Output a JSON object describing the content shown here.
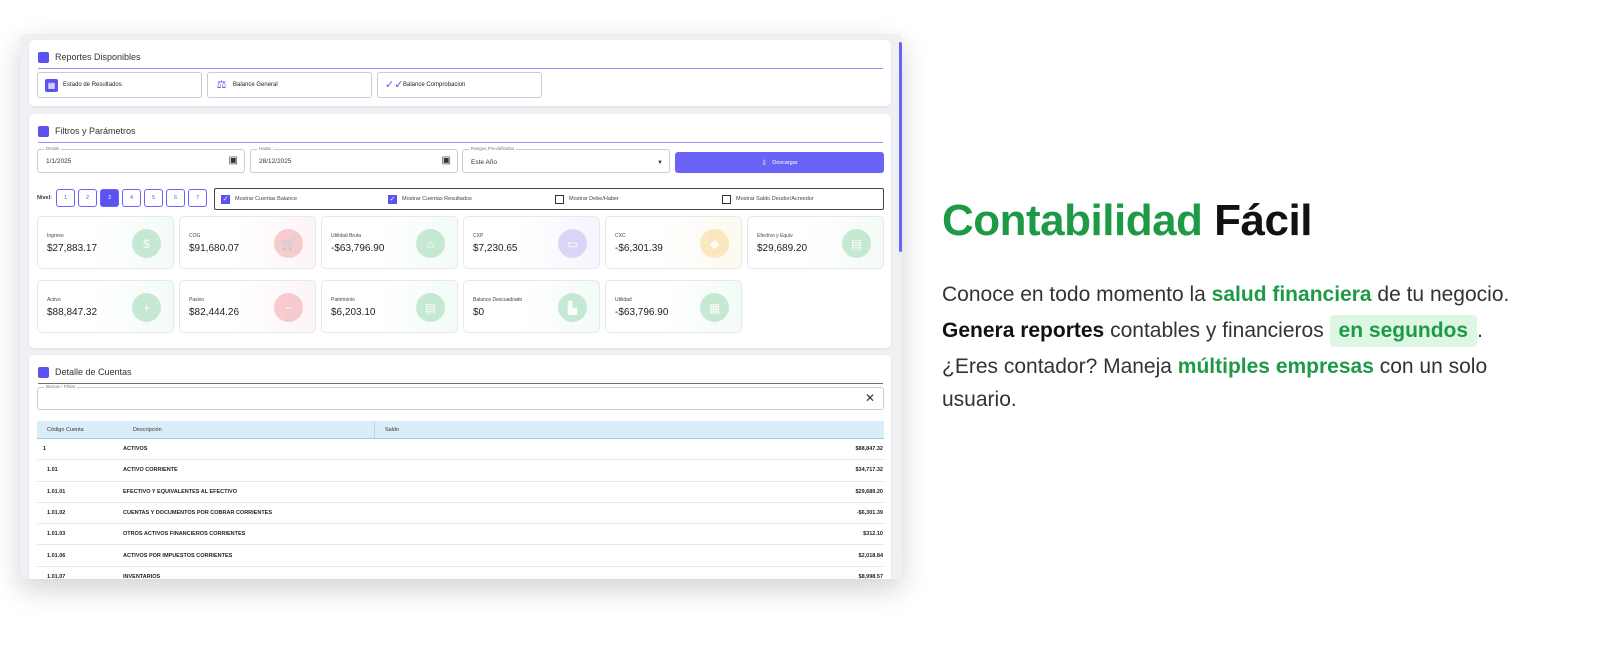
{
  "reports_panel": {
    "title": "Reportes Disponibles",
    "buttons": [
      {
        "label": "Estado de Resultados",
        "icon": "table-icon"
      },
      {
        "label": "Balance General",
        "icon": "scale-icon"
      },
      {
        "label": "Balance Comprobacion",
        "icon": "double-check-icon"
      }
    ]
  },
  "filters_panel": {
    "title": "Filtros y Parámetros",
    "desde_label": "Desde",
    "desde_value": "1/1/2025",
    "hasta_label": "Hasta",
    "hasta_value": "28/12/2025",
    "rangos_label": "Rangos Pre-definidos",
    "rangos_value": "Este Año",
    "download_label": "Descargar",
    "nivel_label": "Nivel:",
    "niveles": [
      "1",
      "2",
      "3",
      "4",
      "5",
      "6",
      "7"
    ],
    "nivel_active": "3",
    "checks": [
      {
        "label": "Mostrar Cuentas Balance",
        "checked": true
      },
      {
        "label": "Mostrar Cuentas Resultados",
        "checked": true
      },
      {
        "label": "Mostrar Debe/Haber",
        "checked": false
      },
      {
        "label": "Mostrar Saldo Deudor/Acreedor",
        "checked": false
      }
    ],
    "cards": [
      {
        "label": "Ingreso",
        "value": "$27,883.17",
        "color": "#9ed9b4",
        "bg": "#f3fbf6",
        "icon": "dollar-icon",
        "glyph": "$"
      },
      {
        "label": "COG",
        "value": "$91,680.07",
        "color": "#f2a8ad",
        "bg": "#fdf4f4",
        "icon": "cart-icon",
        "glyph": "🛒"
      },
      {
        "label": "Utilidad Bruta",
        "value": "-$63,796.90",
        "color": "#9ed9b4",
        "bg": "#f3fbf6",
        "icon": "bank-icon",
        "glyph": "⌂"
      },
      {
        "label": "CXP",
        "value": "$7,230.65",
        "color": "#c4b9f3",
        "bg": "#f6f4fd",
        "icon": "card-icon",
        "glyph": "▭"
      },
      {
        "label": "CXC",
        "value": "-$6,301.39",
        "color": "#f7d895",
        "bg": "#fdf9ef",
        "icon": "tag-icon",
        "glyph": "◆"
      },
      {
        "label": "Efectivo y Equiv.",
        "value": "$29,689.20",
        "color": "#9ed9b4",
        "bg": "#f3fbf6",
        "icon": "cash-icon",
        "glyph": "▤"
      },
      {
        "label": "Activo",
        "value": "$88,847.32",
        "color": "#9ed9b4",
        "bg": "#f3fbf6",
        "icon": "plus-icon",
        "glyph": "+"
      },
      {
        "label": "Pasivo",
        "value": "$82,444.26",
        "color": "#f2a8ad",
        "bg": "#fdf4f4",
        "icon": "minus-icon",
        "glyph": "−"
      },
      {
        "label": "Patrimonio",
        "value": "$6,203.10",
        "color": "#9ed9b4",
        "bg": "#f3fbf6",
        "icon": "wallet-icon",
        "glyph": "▤"
      },
      {
        "label": "Balance Descuadrado",
        "value": "$0",
        "color": "#9ed9b4",
        "bg": "#f3fbf6",
        "icon": "building-icon",
        "glyph": "▙"
      },
      {
        "label": "Utilidad",
        "value": "-$63,796.90",
        "color": "#9ed9b4",
        "bg": "#f3fbf6",
        "icon": "receipt-icon",
        "glyph": "▦"
      }
    ]
  },
  "details_panel": {
    "title": "Detalle de Cuentas",
    "search_label": "Buscar / Filtrar",
    "columns": [
      "Código Cuenta",
      "Descripción",
      "Saldo"
    ],
    "rows": [
      {
        "code": "1",
        "desc": "ACTIVOS",
        "saldo": "$88,847.32"
      },
      {
        "code": "1.01",
        "desc": "ACTIVO CORRIENTE",
        "saldo": "$34,717.32"
      },
      {
        "code": "1.01.01",
        "desc": "EFECTIVO Y EQUIVALENTES AL EFECTIVO",
        "saldo": "$29,689.20"
      },
      {
        "code": "1.01.02",
        "desc": "CUENTAS Y DOCUMENTOS POR COBRAR CORRIENTES",
        "saldo": "-$6,301.39"
      },
      {
        "code": "1.01.03",
        "desc": "OTROS ACTIVOS FINANCIEROS CORRIENTES",
        "saldo": "$312.10"
      },
      {
        "code": "1.01.06",
        "desc": "ACTIVOS POR IMPUESTOS CORRIENTES",
        "saldo": "$2,018.84"
      },
      {
        "code": "1.01.07",
        "desc": "INVENTARIOS",
        "saldo": "$8,998.57"
      }
    ]
  },
  "marketing": {
    "headline_green": "Contabilidad",
    "headline_black": "Fácil",
    "line1_a": "Conoce en todo momento la ",
    "line1_em": "salud financiera",
    "line1_b": " de tu negocio.",
    "line2_bold": "Genera reportes",
    "line2_a": " contables y financieros ",
    "line2_chip": "en segundos",
    "line2_b": ".",
    "line3_a": "¿Eres contador? Maneja ",
    "line3_em": "múltiples empresas",
    "line3_b": " con un solo",
    "line4": "usuario.",
    "accent_color": "#1e9a47",
    "app_accent_color": "#5c52f0"
  }
}
